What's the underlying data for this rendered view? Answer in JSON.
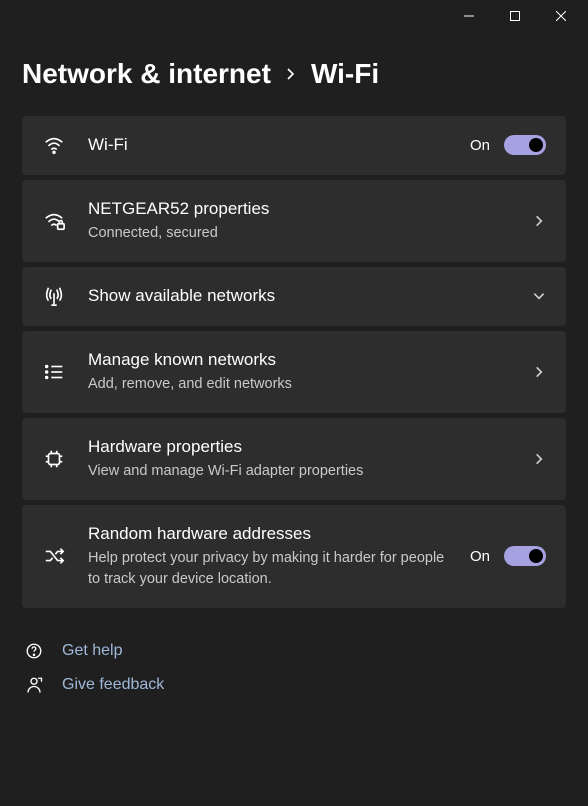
{
  "breadcrumb": {
    "parent": "Network & internet",
    "current": "Wi-Fi"
  },
  "wifi_toggle": {
    "title": "Wi-Fi",
    "state": "On"
  },
  "connection": {
    "title": "NETGEAR52 properties",
    "status": "Connected, secured"
  },
  "available": {
    "title": "Show available networks"
  },
  "known": {
    "title": "Manage known networks",
    "sub": "Add, remove, and edit networks"
  },
  "hardware": {
    "title": "Hardware properties",
    "sub": "View and manage Wi-Fi adapter properties"
  },
  "random_mac": {
    "title": "Random hardware addresses",
    "sub": "Help protect your privacy by making it harder for people to track your device location.",
    "state": "On"
  },
  "help": {
    "get_help": "Get help",
    "feedback": "Give feedback"
  }
}
